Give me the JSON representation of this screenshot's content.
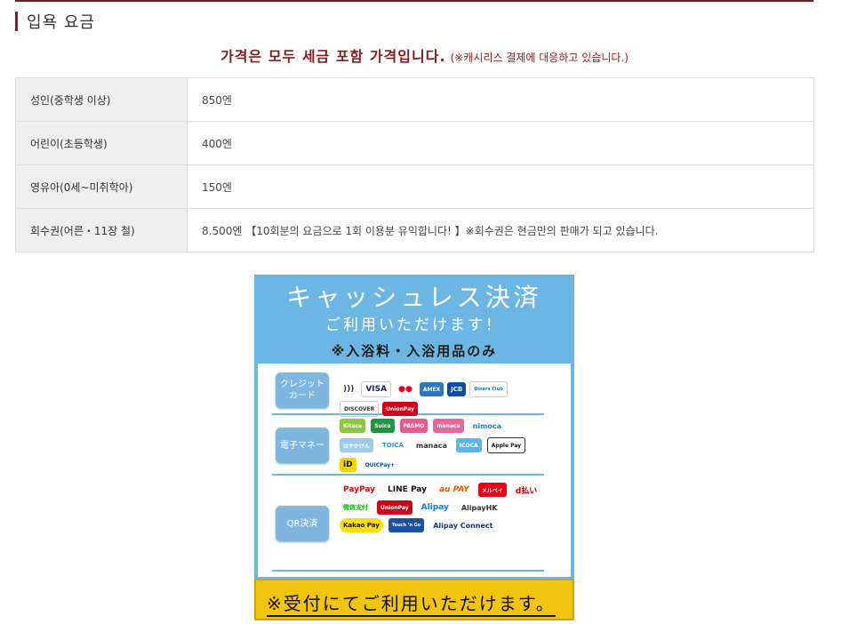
{
  "section": {
    "title": "입욕 요금"
  },
  "notice": {
    "main": "가격은 모두 세금 포함 가격입니다.",
    "sub": "(※캐시리스 결제에 대응하고 있습니다.)"
  },
  "fees": [
    {
      "label": "성인(중학생 이상)",
      "value": "850엔"
    },
    {
      "label": "어린이(초등학생)",
      "value": "400엔"
    },
    {
      "label": "영유아(0세~미취학아)",
      "value": "150엔"
    },
    {
      "label": "회수권(어른・11장 철)",
      "value": "8.500엔 【10회분의 요금으로 1회 이용분 유익합니다! 】※회수권은 현금만의 판매가 되고 있습니다."
    }
  ],
  "banner": {
    "title": "キャッシュレス決済",
    "subtitle": "ご利用いただけます！",
    "note": "※入浴料・入浴用品のみ",
    "footer": "※受付にてご利用いただけます。",
    "credit": {
      "label1": "クレジット",
      "label2": "カード",
      "logos": [
        ")))",
        "VISA",
        "●●",
        "AMEX",
        "JCB",
        "Diners Club",
        "DISCOVER",
        "UnionPay"
      ]
    },
    "emoney": {
      "label": "電子マネー",
      "logos": [
        "Kitaca",
        "Suica",
        "PASMO",
        "manaca",
        "nimoca",
        "はやかけん",
        "TOICA",
        "manaca",
        "ICOCA",
        "Apple Pay",
        "iD",
        "QUICPay+"
      ]
    },
    "qr": {
      "label": "QR決済",
      "logos": [
        "PayPay",
        "LINE Pay",
        "au PAY",
        "メルペイ",
        "d払い",
        "微信支付",
        "UnionPay",
        "Alipay",
        "AlipayHK",
        "Kakao Pay",
        "Touch 'n Go",
        "Alipay Connect"
      ]
    }
  }
}
